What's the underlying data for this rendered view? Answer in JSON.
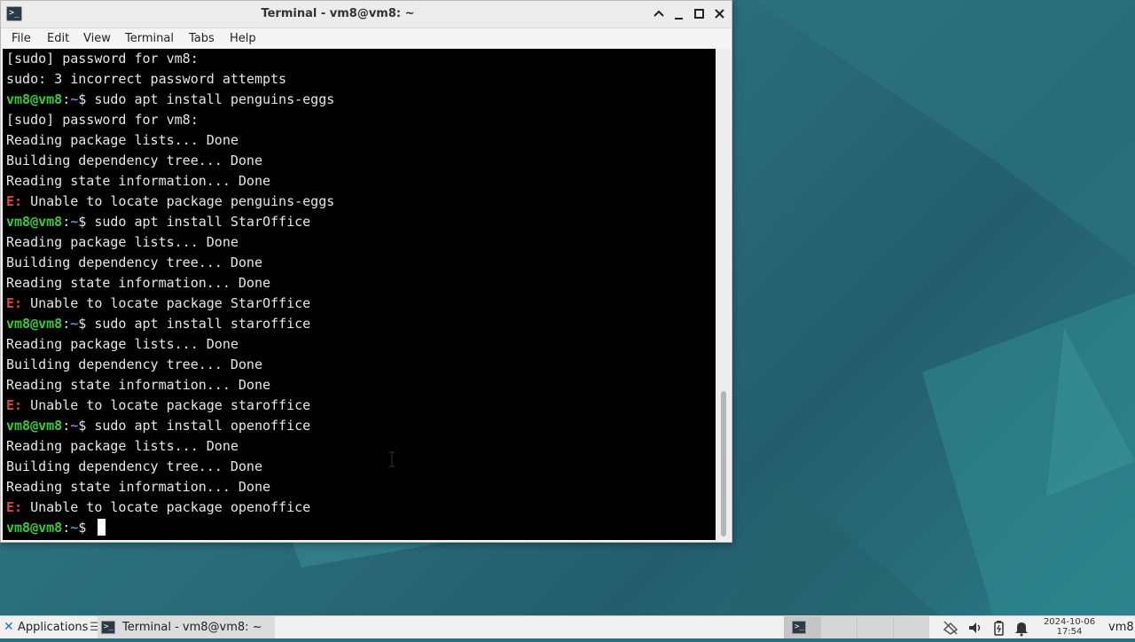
{
  "window": {
    "title": "Terminal - vm8@vm8: ~",
    "controls": {
      "shade": "^",
      "minimize": "_",
      "maximize": "□",
      "close": "✕"
    },
    "app_icon_glyph": ">_"
  },
  "menubar": {
    "items": [
      "File",
      "Edit",
      "View",
      "Terminal",
      "Tabs",
      "Help"
    ]
  },
  "terminal": {
    "prompt_user": "vm8@vm8",
    "prompt_colon": ":",
    "prompt_path": "~",
    "prompt_dollar": "$ ",
    "lines": [
      {
        "kind": "text",
        "text": "[sudo] password for vm8:"
      },
      {
        "kind": "text",
        "text": "sudo: 3 incorrect password attempts"
      },
      {
        "kind": "prompt",
        "text": "sudo apt install penguins-eggs"
      },
      {
        "kind": "text",
        "text": "[sudo] password for vm8:"
      },
      {
        "kind": "text",
        "text": "Reading package lists... Done"
      },
      {
        "kind": "text",
        "text": "Building dependency tree... Done"
      },
      {
        "kind": "text",
        "text": "Reading state information... Done"
      },
      {
        "kind": "error",
        "prefix": "E:",
        "text": " Unable to locate package penguins-eggs"
      },
      {
        "kind": "prompt",
        "text": "sudo apt install StarOffice"
      },
      {
        "kind": "text",
        "text": "Reading package lists... Done"
      },
      {
        "kind": "text",
        "text": "Building dependency tree... Done"
      },
      {
        "kind": "text",
        "text": "Reading state information... Done"
      },
      {
        "kind": "error",
        "prefix": "E:",
        "text": " Unable to locate package StarOffice"
      },
      {
        "kind": "prompt",
        "text": "sudo apt install staroffice"
      },
      {
        "kind": "text",
        "text": "Reading package lists... Done"
      },
      {
        "kind": "text",
        "text": "Building dependency tree... Done"
      },
      {
        "kind": "text",
        "text": "Reading state information... Done"
      },
      {
        "kind": "error",
        "prefix": "E:",
        "text": " Unable to locate package staroffice"
      },
      {
        "kind": "prompt",
        "text": "sudo apt install openoffice"
      },
      {
        "kind": "text",
        "text": "Reading package lists... Done"
      },
      {
        "kind": "text",
        "text": "Building dependency tree... Done"
      },
      {
        "kind": "text",
        "text": "Reading state information... Done"
      },
      {
        "kind": "error",
        "prefix": "E:",
        "text": " Unable to locate package openoffice"
      },
      {
        "kind": "cursor",
        "text": ""
      }
    ],
    "colors": {
      "background": "#000000",
      "foreground": "#e6e6e6",
      "prompt_user": "#39c93d",
      "prompt_path": "#5a8fd6",
      "error": "#e0443e"
    }
  },
  "taskbar": {
    "applications_label": "Applications",
    "applications_sep": "☰",
    "task_label": "Terminal - vm8@vm8: ~",
    "workspaces": 4,
    "tray_icons": [
      "network-icon",
      "volume-icon",
      "battery-icon",
      "notification-bell-icon"
    ],
    "clock_date": "2024-10-06",
    "clock_time": "17:54",
    "user": "vm8"
  }
}
